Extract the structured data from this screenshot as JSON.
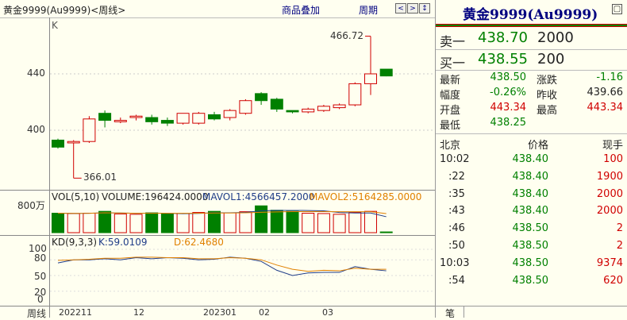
{
  "topbar": {
    "title": "黄金9999(Au9999)<周线>",
    "overlay_label": "商品叠加",
    "period_label": "周期",
    "nav_buttons": [
      "<",
      ">",
      "↕"
    ]
  },
  "main_chart": {
    "label": "K",
    "y_ticks": [
      "440",
      "400"
    ],
    "high_label": "466.72",
    "low_label": "366.01",
    "colors": {
      "up": "#d00000",
      "down": "#008000",
      "ma1": "#1f3c88",
      "ma2": "#e08000"
    }
  },
  "volume": {
    "y_tick": "800万",
    "header_label": "VOL(5,10)",
    "volume_text": "VOLUME:196424.0000",
    "mavol1_text": "MAVOL1:4566457.2000",
    "mavol2_text": "MAVOL2:5164285.0000"
  },
  "kd": {
    "header_label": "KD(9,3,3)",
    "k_text": "K:59.0109",
    "d_text": "D:62.4680",
    "y_ticks": [
      "100",
      "80",
      "50",
      "20",
      "0"
    ]
  },
  "x_axis": {
    "period": "周线",
    "labels": [
      "202211",
      "12",
      "202301",
      "02",
      "03"
    ]
  },
  "chart_data": {
    "type": "candlestick",
    "title": "黄金9999(Au9999)<周线>",
    "candles": [
      {
        "open": 393,
        "close": 388,
        "high": 394,
        "low": 387
      },
      {
        "open": 391,
        "close": 392,
        "high": 393,
        "low": 366.01
      },
      {
        "open": 392,
        "close": 408,
        "high": 410,
        "low": 391
      },
      {
        "open": 412,
        "close": 407,
        "high": 414,
        "low": 402
      },
      {
        "open": 406,
        "close": 407,
        "high": 409,
        "low": 405
      },
      {
        "open": 409,
        "close": 410,
        "high": 411,
        "low": 407
      },
      {
        "open": 409,
        "close": 406,
        "high": 411,
        "low": 404
      },
      {
        "open": 407,
        "close": 405,
        "high": 409,
        "low": 403
      },
      {
        "open": 405,
        "close": 412,
        "high": 412,
        "low": 404
      },
      {
        "open": 405,
        "close": 412,
        "high": 413,
        "low": 404
      },
      {
        "open": 411,
        "close": 408,
        "high": 413,
        "low": 407
      },
      {
        "open": 409,
        "close": 414,
        "high": 415,
        "low": 407
      },
      {
        "open": 412,
        "close": 421,
        "high": 422,
        "low": 411
      },
      {
        "open": 426,
        "close": 421,
        "high": 427,
        "low": 418
      },
      {
        "open": 422,
        "close": 415,
        "high": 423,
        "low": 413
      },
      {
        "open": 414,
        "close": 413,
        "high": 414,
        "low": 412
      },
      {
        "open": 413,
        "close": 415,
        "high": 416,
        "low": 412
      },
      {
        "open": 414,
        "close": 417,
        "high": 418,
        "low": 413
      },
      {
        "open": 416,
        "close": 418,
        "high": 419,
        "low": 415
      },
      {
        "open": 418,
        "close": 433,
        "high": 434,
        "low": 417
      },
      {
        "open": 433,
        "close": 440,
        "high": 466.72,
        "low": 425
      },
      {
        "open": 443.34,
        "close": 438.5,
        "high": 443.34,
        "low": 438.25
      }
    ],
    "volume": [
      5.3,
      5.2,
      5.3,
      5.8,
      5.1,
      5.0,
      5.4,
      5.1,
      5.2,
      5.5,
      5.8,
      5.4,
      5.7,
      7.3,
      6.1,
      5.8,
      5.3,
      5.2,
      5.0,
      5.5,
      5.8,
      0.2
    ],
    "volume_ylim": [
      0,
      8
    ],
    "kd_k": [
      74,
      80,
      80,
      82,
      80,
      84,
      82,
      84,
      83,
      80,
      81,
      85,
      83,
      77,
      60,
      50,
      55,
      56,
      56,
      67,
      62,
      59
    ],
    "kd_d": [
      79,
      80,
      81,
      83,
      83,
      85,
      85,
      84,
      84,
      82,
      82,
      84,
      83,
      80,
      70,
      62,
      58,
      60,
      59,
      64,
      62,
      62
    ],
    "kd_ylim": [
      0,
      100
    ],
    "price_ylim": [
      360,
      475
    ],
    "x_labels": [
      "202211",
      "12",
      "202301",
      "02",
      "03"
    ]
  },
  "quote": {
    "title": "黄金9999(Au9999)",
    "sell_label": "卖一",
    "sell_price": "438.70",
    "sell_vol": "2000",
    "buy_label": "买一",
    "buy_price": "438.55",
    "buy_vol": "200",
    "stats": [
      {
        "label": "最新",
        "value": "438.50",
        "label2": "涨跌",
        "value2": "-1.16"
      },
      {
        "label": "幅度",
        "value": "-0.26%",
        "label2": "昨收",
        "value2": "439.66"
      },
      {
        "label": "开盘",
        "value": "443.34",
        "label2": "最高",
        "value2": "443.34"
      },
      {
        "label": "最低",
        "value": "438.25",
        "label2": "",
        "value2": ""
      }
    ],
    "trade_headers": {
      "location": "北京",
      "price": "价格",
      "volume": "现手"
    },
    "trades": [
      {
        "time": "10:02",
        "price": "438.40",
        "volume": "100"
      },
      {
        "time": ":22",
        "price": "438.40",
        "volume": "1900"
      },
      {
        "time": ":35",
        "price": "438.40",
        "volume": "2000"
      },
      {
        "time": ":43",
        "price": "438.40",
        "volume": "2000"
      },
      {
        "time": ":46",
        "price": "438.50",
        "volume": "2"
      },
      {
        "time": ":50",
        "price": "438.50",
        "volume": "2"
      },
      {
        "time": "10:03",
        "price": "438.50",
        "volume": "9374"
      },
      {
        "time": ":54",
        "price": "438.50",
        "volume": "620"
      }
    ],
    "bottom_tab": "笔"
  }
}
